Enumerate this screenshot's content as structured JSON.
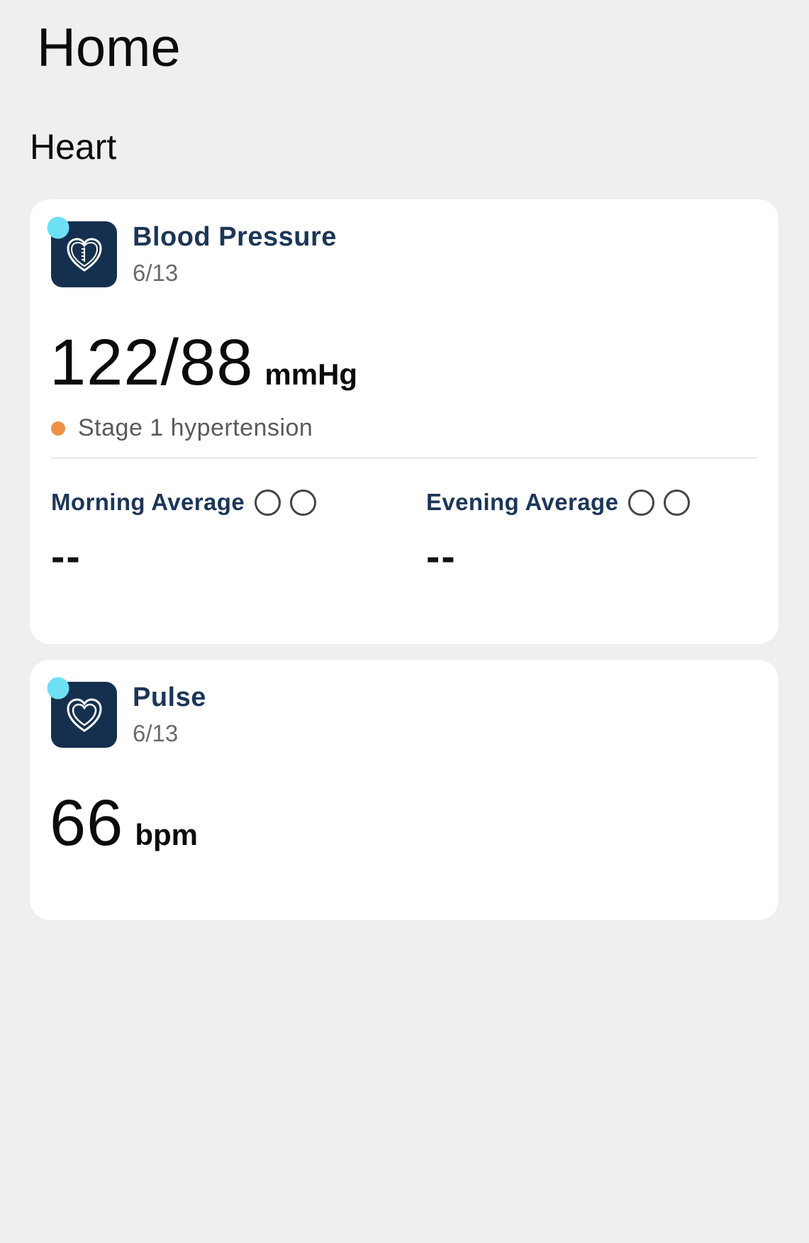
{
  "page": {
    "title": "Home",
    "section": "Heart"
  },
  "cards": {
    "blood_pressure": {
      "name": "Blood Pressure",
      "date": "6/13",
      "icon": "heart-gauge-icon",
      "value": "122/88",
      "unit": "mmHg",
      "status": "Stage 1 hypertension",
      "status_color": "#ef9144",
      "morning_label": "Morning Average",
      "morning_value": "--",
      "evening_label": "Evening Average",
      "evening_value": "--"
    },
    "pulse": {
      "name": "Pulse",
      "date": "6/13",
      "icon": "heart-icon",
      "value": "66",
      "unit": "bpm"
    }
  },
  "colors": {
    "background": "#efefef",
    "card": "#ffffff",
    "icon_tile": "#15304f",
    "new_indicator": "#6ee0f5",
    "heading_navy": "#1c3658"
  }
}
